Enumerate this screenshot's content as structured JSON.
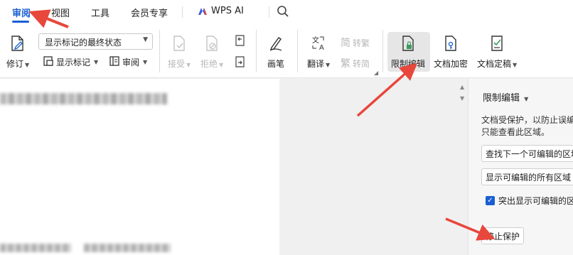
{
  "tabs": [
    {
      "label": "审阅",
      "active": true
    },
    {
      "label": "视图"
    },
    {
      "label": "工具"
    },
    {
      "label": "会员专享"
    },
    {
      "label": "WPS AI"
    }
  ],
  "ribbon": {
    "markup_display": "显示标记的最终状态",
    "revise": "修订",
    "show_markup": "显示标记",
    "review_pane": "审阅",
    "accept": "接受",
    "reject": "拒绝",
    "pen": "画笔",
    "translate": "翻译",
    "to_traditional": "转繁",
    "to_simplified": "转简",
    "trad_glyph": "简",
    "simp_glyph": "繁",
    "restrict_editing": "限制编辑",
    "encrypt": "文档加密",
    "finalize": "文档定稿"
  },
  "pane": {
    "title": "限制编辑",
    "description": "文档受保护，以防止误编辑。只能查看此区域。",
    "find_next": "查找下一个可编辑的区域",
    "show_all": "显示可编辑的所有区域",
    "highlight_label": "突出显示可编辑的区域",
    "highlight_checked": true,
    "stop_button": "停止保护"
  },
  "colors": {
    "accent": "#1a5fd1",
    "annotation": "#e8473c"
  }
}
